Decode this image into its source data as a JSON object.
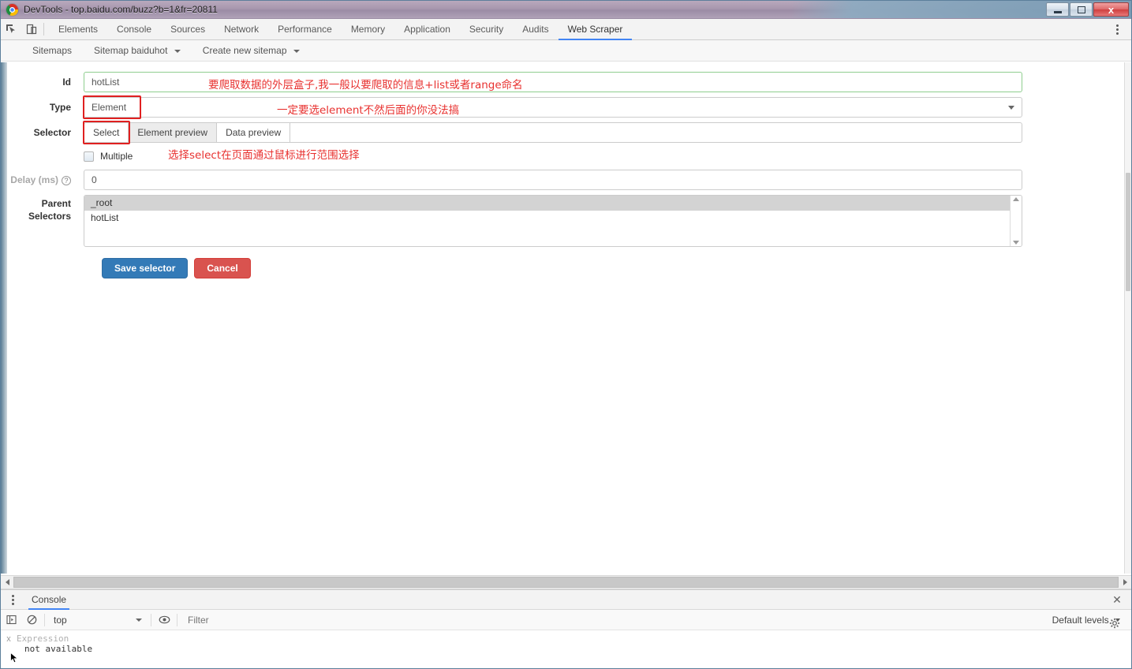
{
  "window": {
    "title": "DevTools - top.baidu.com/buzz?b=1&fr=20811",
    "minimize_label": "Minimize",
    "maximize_label": "Maximize",
    "close_label": "x"
  },
  "devtools": {
    "tabs": [
      {
        "label": "Elements",
        "active": false
      },
      {
        "label": "Console",
        "active": false
      },
      {
        "label": "Sources",
        "active": false
      },
      {
        "label": "Network",
        "active": false
      },
      {
        "label": "Performance",
        "active": false
      },
      {
        "label": "Memory",
        "active": false
      },
      {
        "label": "Application",
        "active": false
      },
      {
        "label": "Security",
        "active": false
      },
      {
        "label": "Audits",
        "active": false
      },
      {
        "label": "Web Scraper",
        "active": true
      }
    ],
    "inspect_icon": "inspect-element-icon",
    "device_icon": "device-toolbar-icon",
    "menu_icon": "more-options-icon",
    "accent_color": "#4285f4"
  },
  "webscraper_nav": {
    "items": [
      {
        "label": "Sitemaps",
        "has_caret": false
      },
      {
        "label": "Sitemap baiduhot",
        "has_caret": true
      },
      {
        "label": "Create new sitemap",
        "has_caret": true
      }
    ]
  },
  "form": {
    "id": {
      "label": "Id",
      "value": "hotList",
      "annotation": "要爬取数据的外层盒子,我一般以要爬取的信息+list或者range命名"
    },
    "type": {
      "label": "Type",
      "value": "Element",
      "annotation": "一定要选element不然后面的你没法搞",
      "caret_icon": "chevron-down-icon"
    },
    "selector": {
      "label": "Selector",
      "buttons": [
        {
          "label": "Select",
          "highlighted": true
        },
        {
          "label": "Element preview",
          "highlighted": false
        },
        {
          "label": "Data preview",
          "highlighted": false
        }
      ],
      "value": ""
    },
    "multiple": {
      "label": "Multiple",
      "checked": false,
      "annotation": "选择select在页面通过鼠标进行范围选择"
    },
    "delay": {
      "label": "Delay (ms)",
      "help_icon": "help-question-icon",
      "value": "0"
    },
    "parent_selectors": {
      "label_line1": "Parent",
      "label_line2": "Selectors",
      "options": [
        {
          "label": "_root",
          "selected": true
        },
        {
          "label": "hotList",
          "selected": false
        }
      ],
      "scroll_up_icon": "scroll-up-arrow-icon",
      "scroll_down_icon": "scroll-down-arrow-icon"
    },
    "actions": {
      "save_label": "Save selector",
      "cancel_label": "Cancel",
      "save_color": "#337ab7",
      "cancel_color": "#d9534f"
    },
    "highlight_color": "#e02020",
    "annotation_color": "#e8312f"
  },
  "drawer": {
    "tab_label": "Console",
    "menu_icon": "drawer-more-options-icon",
    "close_icon": "close-drawer-icon",
    "toolbar": {
      "sidebar_icon": "console-sidebar-icon",
      "clear_icon": "clear-console-icon",
      "context_value": "top",
      "context_caret_icon": "chevron-down-icon",
      "eye_icon": "live-expression-eye-icon",
      "filter_placeholder": "Filter",
      "levels_label": "Default levels",
      "levels_caret_icon": "chevron-down-icon",
      "settings_icon": "console-settings-gear-icon"
    },
    "messages": [
      {
        "remove_icon": "x",
        "expression": "Expression",
        "detail": "not available"
      }
    ]
  },
  "scrollbars": {
    "h_left_icon": "scroll-left-arrow-icon",
    "h_right_icon": "scroll-right-arrow-icon"
  }
}
